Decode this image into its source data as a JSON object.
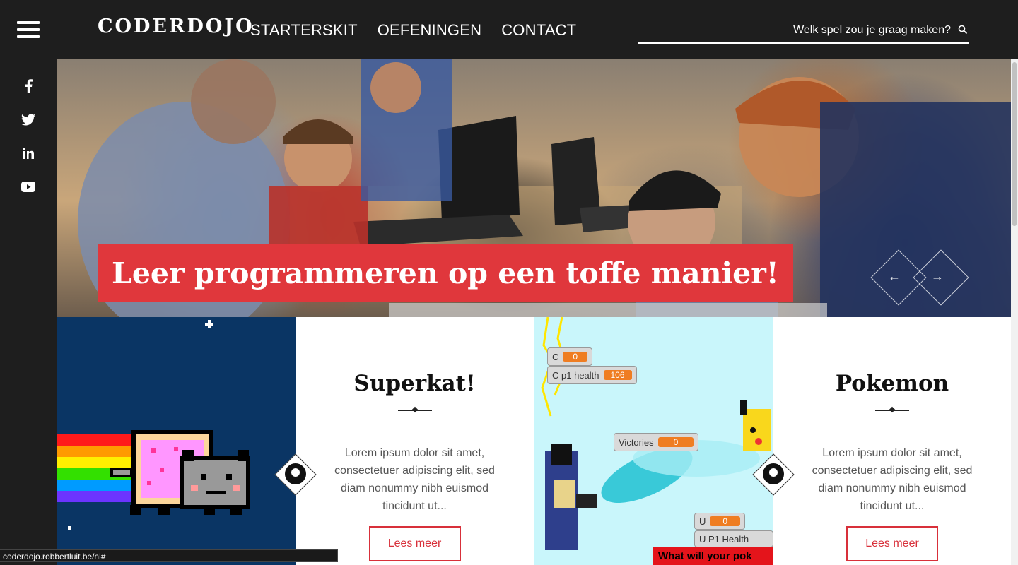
{
  "header": {
    "logo": "CODERDOJO",
    "nav": [
      "STARTERSKIT",
      "OEFENINGEN",
      "CONTACT"
    ],
    "search_placeholder": "Welk spel zou je graag maken?"
  },
  "social": [
    "facebook-icon",
    "twitter-icon",
    "linkedin-icon",
    "youtube-icon"
  ],
  "hero": {
    "title": "Leer programmeren op een toffe manier!",
    "prev_glyph": "←",
    "next_glyph": "→"
  },
  "cards": [
    {
      "title": "Superkat!",
      "description": "Lorem ipsum dolor sit amet, consectetuer adipiscing elit, sed diam nonummy nibh euismod tincidunt ut...",
      "button": "Lees meer"
    },
    {
      "title": "Pokemon",
      "description": "Lorem ipsum dolor sit amet, consectetuer adipiscing elit, sed diam nonummy nibh euismod tincidunt ut...",
      "button": "Lees meer"
    }
  ],
  "game_screen": {
    "vars": [
      {
        "name": "C",
        "value": "0"
      },
      {
        "name": "C p1 health",
        "value": "106"
      },
      {
        "name": "Victories",
        "value": "0"
      },
      {
        "name": "U",
        "value": "0"
      },
      {
        "name": "U P1 Health",
        "value": ""
      }
    ],
    "banner": "What will your pok"
  },
  "status_url": "coderdojo.robbertluit.be/nl#",
  "colors": {
    "accent": "#e0373c",
    "dark": "#1e1e1e",
    "nyan_bg": "#0a3564",
    "scratch_bg": "#c9f6fb"
  }
}
